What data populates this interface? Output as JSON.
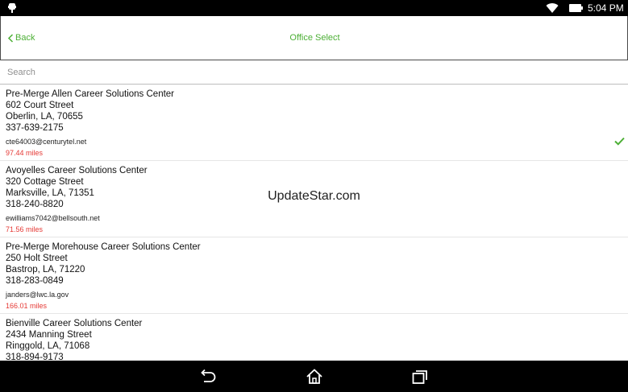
{
  "status_bar": {
    "time": "5:04 PM"
  },
  "header": {
    "back_label": "Back",
    "title": "Office Select"
  },
  "search": {
    "placeholder": "Search",
    "value": ""
  },
  "offices": [
    {
      "name": "Pre-Merge Allen Career Solutions Center",
      "street": "602 Court Street",
      "city": "Oberlin, LA, 70655",
      "phone": "337-639-2175",
      "email": "cte64003@centurytel.net",
      "distance": "97.44 miles",
      "selected": true
    },
    {
      "name": "Avoyelles Career Solutions Center",
      "street": "320 Cottage Street",
      "city": "Marksville, LA, 71351",
      "phone": "318-240-8820",
      "email": "ewilliams7042@bellsouth.net",
      "distance": "71.56 miles",
      "selected": false
    },
    {
      "name": "Pre-Merge Morehouse Career Solutions Center",
      "street": "250 Holt Street",
      "city": "Bastrop, LA, 71220",
      "phone": "318-283-0849",
      "email": "janders@lwc.la.gov",
      "distance": "166.01 miles",
      "selected": false
    },
    {
      "name": "Bienville Career Solutions Center",
      "street": "2434 Manning Street",
      "city": "Ringgold, LA, 71068",
      "phone": "318-894-9173",
      "email": "",
      "distance": "",
      "selected": false
    }
  ],
  "watermark": "UpdateStar.com",
  "colors": {
    "accent": "#4caf35",
    "distance": "#e53935"
  }
}
